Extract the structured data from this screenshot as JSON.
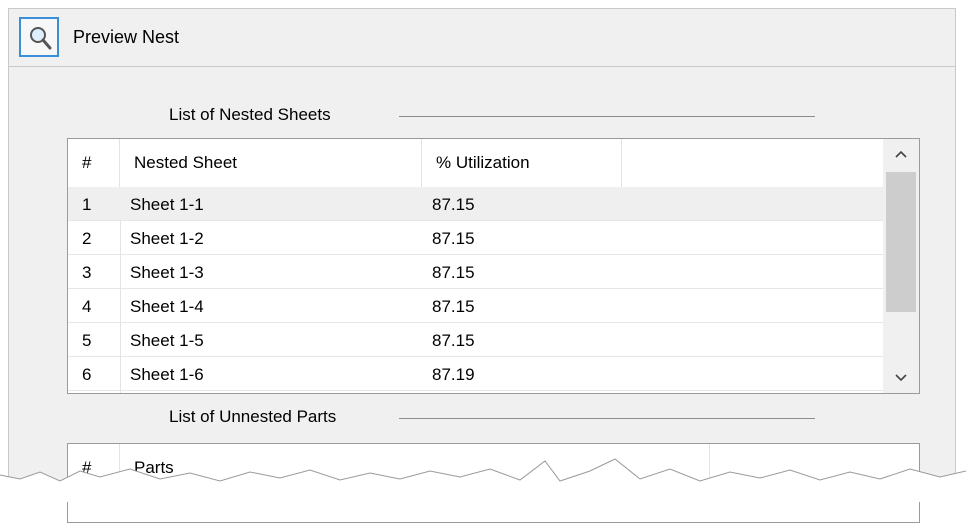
{
  "header": {
    "title": "Preview Nest",
    "icon": "magnifier-icon"
  },
  "nested_section": {
    "label": "List of Nested Sheets",
    "columns": [
      "#",
      "Nested Sheet",
      "% Utilization"
    ],
    "rows": [
      {
        "num": "1",
        "name": "Sheet 1-1",
        "util": "87.15"
      },
      {
        "num": "2",
        "name": "Sheet 1-2",
        "util": "87.15"
      },
      {
        "num": "3",
        "name": "Sheet 1-3",
        "util": "87.15"
      },
      {
        "num": "4",
        "name": "Sheet 1-4",
        "util": "87.15"
      },
      {
        "num": "5",
        "name": "Sheet 1-5",
        "util": "87.15"
      },
      {
        "num": "6",
        "name": "Sheet 1-6",
        "util": "87.19"
      }
    ],
    "scroll_up": "^",
    "scroll_down": "v"
  },
  "unnested_section": {
    "label": "List of Unnested Parts",
    "columns": [
      "#",
      "Parts"
    ]
  },
  "colors": {
    "accent": "#3b8fd8",
    "panel_bg": "#f0f0f0",
    "selected_row": "#efefef"
  }
}
